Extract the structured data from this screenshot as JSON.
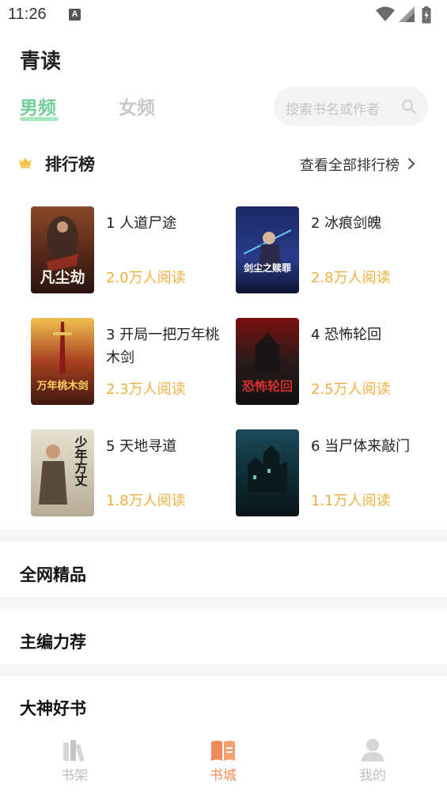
{
  "status_bar": {
    "time": "11:26",
    "notification_icon": "A"
  },
  "app": {
    "title": "青读"
  },
  "tabs": [
    {
      "label": "男频",
      "active": true
    },
    {
      "label": "女频",
      "active": false
    }
  ],
  "search": {
    "placeholder": "搜索书名或作者",
    "icon": "search-icon"
  },
  "ranking": {
    "title": "排行榜",
    "view_all": "查看全部排行榜",
    "icon": "crown-icon",
    "books": [
      {
        "title": "1 人道尸途",
        "reads": "2.0万人阅读",
        "cover_text": "凡尘劫"
      },
      {
        "title": "2 冰痕剑魄",
        "reads": "2.8万人阅读",
        "cover_text": "剑尘之赎罪"
      },
      {
        "title": "3 开局一把万年桃木剑",
        "reads": "2.3万人阅读",
        "cover_text": "万年桃木剑"
      },
      {
        "title": "4 恐怖轮回",
        "reads": "2.5万人阅读",
        "cover_text": "恐怖轮回"
      },
      {
        "title": "5 天地寻道",
        "reads": "1.8万人阅读",
        "cover_text": "少年方丈"
      },
      {
        "title": "6 当尸体来敲门",
        "reads": "1.1万人阅读",
        "cover_text": ""
      }
    ]
  },
  "sections": [
    {
      "label": "全网精品"
    },
    {
      "label": "主编力荐"
    },
    {
      "label": "大神好书"
    }
  ],
  "bottom_nav": [
    {
      "label": "书架",
      "icon": "bookshelf-icon",
      "active": false
    },
    {
      "label": "书城",
      "icon": "book-store-icon",
      "active": true
    },
    {
      "label": "我的",
      "icon": "profile-icon",
      "active": false
    }
  ],
  "colors": {
    "accent_green": "#6fcf97",
    "read_count": "#f0b040",
    "nav_active": "#f28b5a",
    "nav_inactive": "#bdbdbd"
  }
}
